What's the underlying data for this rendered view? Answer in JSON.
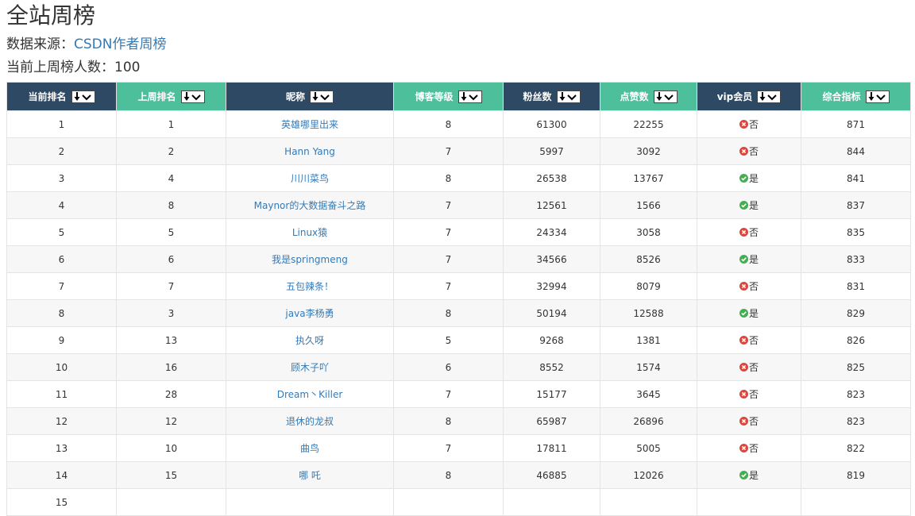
{
  "page": {
    "title": "全站周榜",
    "source_label": "数据来源：",
    "source_link": "CSDN作者周榜",
    "count_label": "当前上周榜人数：",
    "count_value": "100"
  },
  "colors": {
    "header_dark": "#2e4964",
    "header_green": "#4dbf9b",
    "link": "#337ab7",
    "vip_yes": "#3fb24f",
    "vip_no": "#e0453b"
  },
  "table": {
    "columns": [
      {
        "label": "当前排名",
        "style": "dark"
      },
      {
        "label": "上周排名",
        "style": "green"
      },
      {
        "label": "昵称",
        "style": "dark"
      },
      {
        "label": "博客等级",
        "style": "green"
      },
      {
        "label": "粉丝数",
        "style": "dark"
      },
      {
        "label": "点赞数",
        "style": "green"
      },
      {
        "label": "vip会员",
        "style": "dark"
      },
      {
        "label": "综合指标",
        "style": "green"
      }
    ],
    "sort_icon": "arrow-down-chevron-icon",
    "rows": [
      {
        "rank": "1",
        "last": "1",
        "nick": "英雄哪里出来",
        "level": "8",
        "fans": "61300",
        "likes": "22255",
        "vip": "否",
        "vip_status": "no",
        "score": "871"
      },
      {
        "rank": "2",
        "last": "2",
        "nick": "Hann Yang",
        "level": "7",
        "fans": "5997",
        "likes": "3092",
        "vip": "否",
        "vip_status": "no",
        "score": "844"
      },
      {
        "rank": "3",
        "last": "4",
        "nick": "川川菜鸟",
        "level": "8",
        "fans": "26538",
        "likes": "13767",
        "vip": "是",
        "vip_status": "yes",
        "score": "841"
      },
      {
        "rank": "4",
        "last": "8",
        "nick": "Maynor的大数据奋斗之路",
        "level": "7",
        "fans": "12561",
        "likes": "1566",
        "vip": "是",
        "vip_status": "yes",
        "score": "837"
      },
      {
        "rank": "5",
        "last": "5",
        "nick": "Linux猿",
        "level": "7",
        "fans": "24334",
        "likes": "3058",
        "vip": "否",
        "vip_status": "no",
        "score": "835"
      },
      {
        "rank": "6",
        "last": "6",
        "nick": "我是springmeng",
        "level": "7",
        "fans": "34566",
        "likes": "8526",
        "vip": "是",
        "vip_status": "yes",
        "score": "833"
      },
      {
        "rank": "7",
        "last": "7",
        "nick": "五包辣条！",
        "level": "7",
        "fans": "32994",
        "likes": "8079",
        "vip": "否",
        "vip_status": "no",
        "score": "831"
      },
      {
        "rank": "8",
        "last": "3",
        "nick": "java李杨勇",
        "level": "8",
        "fans": "50194",
        "likes": "12588",
        "vip": "是",
        "vip_status": "yes",
        "score": "829"
      },
      {
        "rank": "9",
        "last": "13",
        "nick": "执久呀",
        "level": "5",
        "fans": "9268",
        "likes": "1381",
        "vip": "否",
        "vip_status": "no",
        "score": "826"
      },
      {
        "rank": "10",
        "last": "16",
        "nick": "顾木子吖",
        "level": "6",
        "fans": "8552",
        "likes": "1574",
        "vip": "否",
        "vip_status": "no",
        "score": "825"
      },
      {
        "rank": "11",
        "last": "28",
        "nick": "Dream丶Killer",
        "level": "7",
        "fans": "15177",
        "likes": "3645",
        "vip": "否",
        "vip_status": "no",
        "score": "823"
      },
      {
        "rank": "12",
        "last": "12",
        "nick": "退休的龙叔",
        "level": "8",
        "fans": "65987",
        "likes": "26896",
        "vip": "否",
        "vip_status": "no",
        "score": "823"
      },
      {
        "rank": "13",
        "last": "10",
        "nick": "曲鸟",
        "level": "7",
        "fans": "17811",
        "likes": "5005",
        "vip": "否",
        "vip_status": "no",
        "score": "822"
      },
      {
        "rank": "14",
        "last": "15",
        "nick": "哪 吒",
        "level": "8",
        "fans": "46885",
        "likes": "12026",
        "vip": "是",
        "vip_status": "yes",
        "score": "819"
      },
      {
        "rank": "15",
        "last": "",
        "nick": "",
        "level": "",
        "fans": "",
        "likes": "",
        "vip": "",
        "vip_status": "none",
        "score": ""
      }
    ]
  }
}
